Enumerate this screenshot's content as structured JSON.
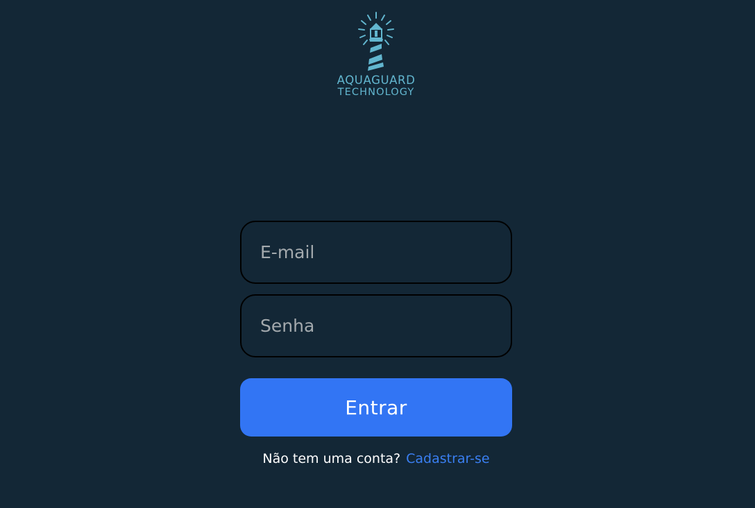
{
  "brand": {
    "line1": "AQUAGUARD",
    "line2": "TECHNOLOGY",
    "logo_icon": "lighthouse-icon",
    "color": "#62b6cf"
  },
  "login_form": {
    "email": {
      "placeholder": "E-mail",
      "value": ""
    },
    "password": {
      "placeholder": "Senha",
      "value": ""
    },
    "submit_label": "Entrar",
    "submit_color": "#3275f4"
  },
  "signup": {
    "prompt": "Não tem uma conta?",
    "link_label": "Cadastrar-se",
    "link_color": "#3a7ff2"
  },
  "theme": {
    "background": "#132736"
  }
}
